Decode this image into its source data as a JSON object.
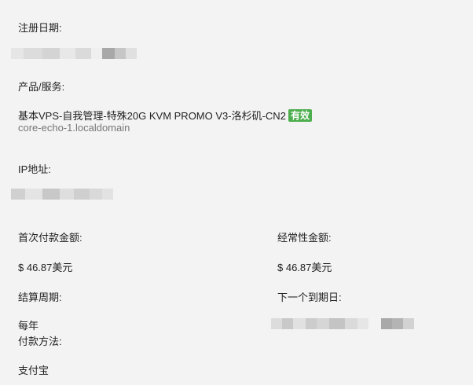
{
  "registration": {
    "label": "注册日期:"
  },
  "product": {
    "label": "产品/服务:",
    "name": "基本VPS-自我管理-特殊20G KVM PROMO V3-洛杉矶-CN2",
    "status": "有效",
    "hostname": "core-echo-1.localdomain"
  },
  "ip": {
    "label": "IP地址:"
  },
  "first_payment": {
    "label": "首次付款金额:",
    "value": "$ 46.87美元"
  },
  "recurring": {
    "label": "经常性金额:",
    "value": "$ 46.87美元"
  },
  "billing_cycle": {
    "label": "结算周期:",
    "value": "每年"
  },
  "next_due": {
    "label": "下一个到期日:"
  },
  "payment_method": {
    "label": "付款方法:",
    "value": "支付宝"
  },
  "colors": {
    "background": "#f3f3f3",
    "badge_green": "#4cae4c",
    "muted_text": "#777777"
  }
}
